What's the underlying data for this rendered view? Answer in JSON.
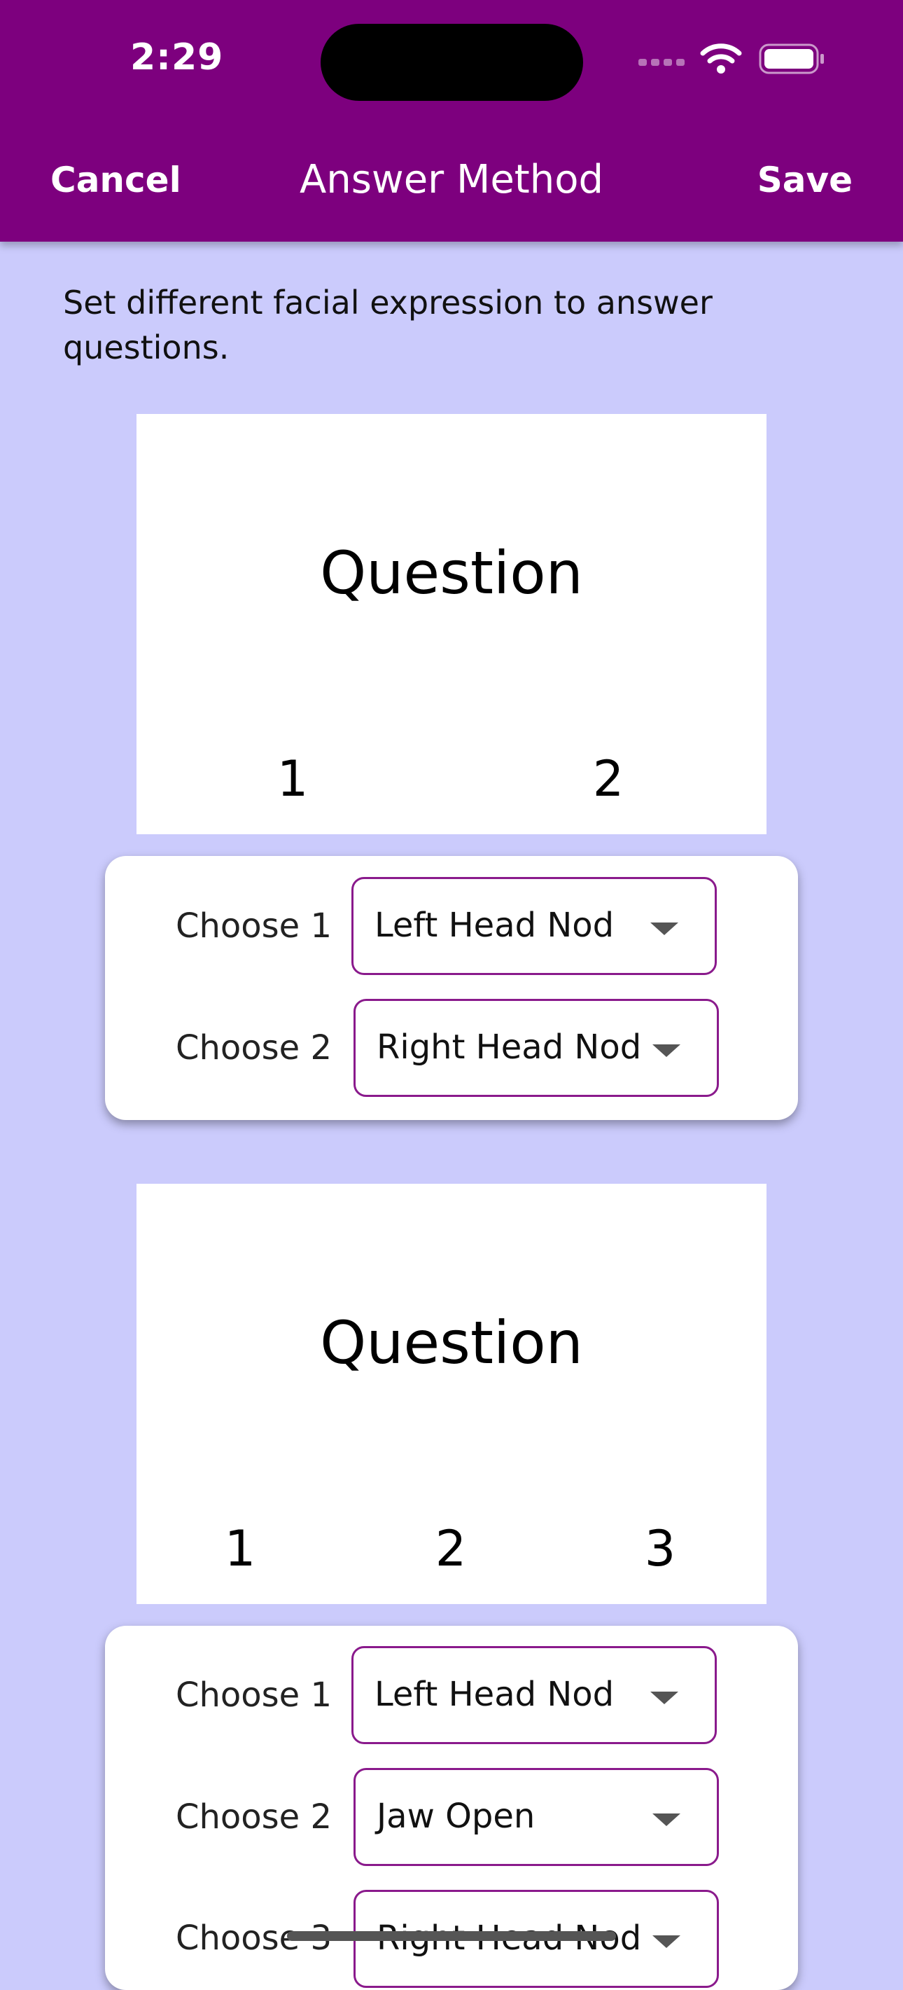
{
  "status_bar": {
    "time": "2:29"
  },
  "nav": {
    "cancel": "Cancel",
    "title": "Answer Method",
    "save": "Save"
  },
  "instructions": "Set different facial expression to answer questions.",
  "questions": [
    {
      "preview_title": "Question",
      "options": [
        "1",
        "2"
      ],
      "choices": [
        {
          "label": "Choose 1",
          "value": "Left Head Nod"
        },
        {
          "label": "Choose 2",
          "value": "Right Head Nod"
        }
      ]
    },
    {
      "preview_title": "Question",
      "options": [
        "1",
        "2",
        "3"
      ],
      "choices": [
        {
          "label": "Choose 1",
          "value": "Left Head Nod"
        },
        {
          "label": "Choose 2",
          "value": "Jaw Open"
        },
        {
          "label": "Choose 3",
          "value": "Right Head Nod"
        }
      ]
    }
  ],
  "colors": {
    "header": "#7D007E",
    "background": "#CBCBFC",
    "dropdown_border": "#8A1A8C"
  },
  "icons": [
    "signal-icon",
    "wifi-icon",
    "battery-icon",
    "caret-down-icon"
  ]
}
